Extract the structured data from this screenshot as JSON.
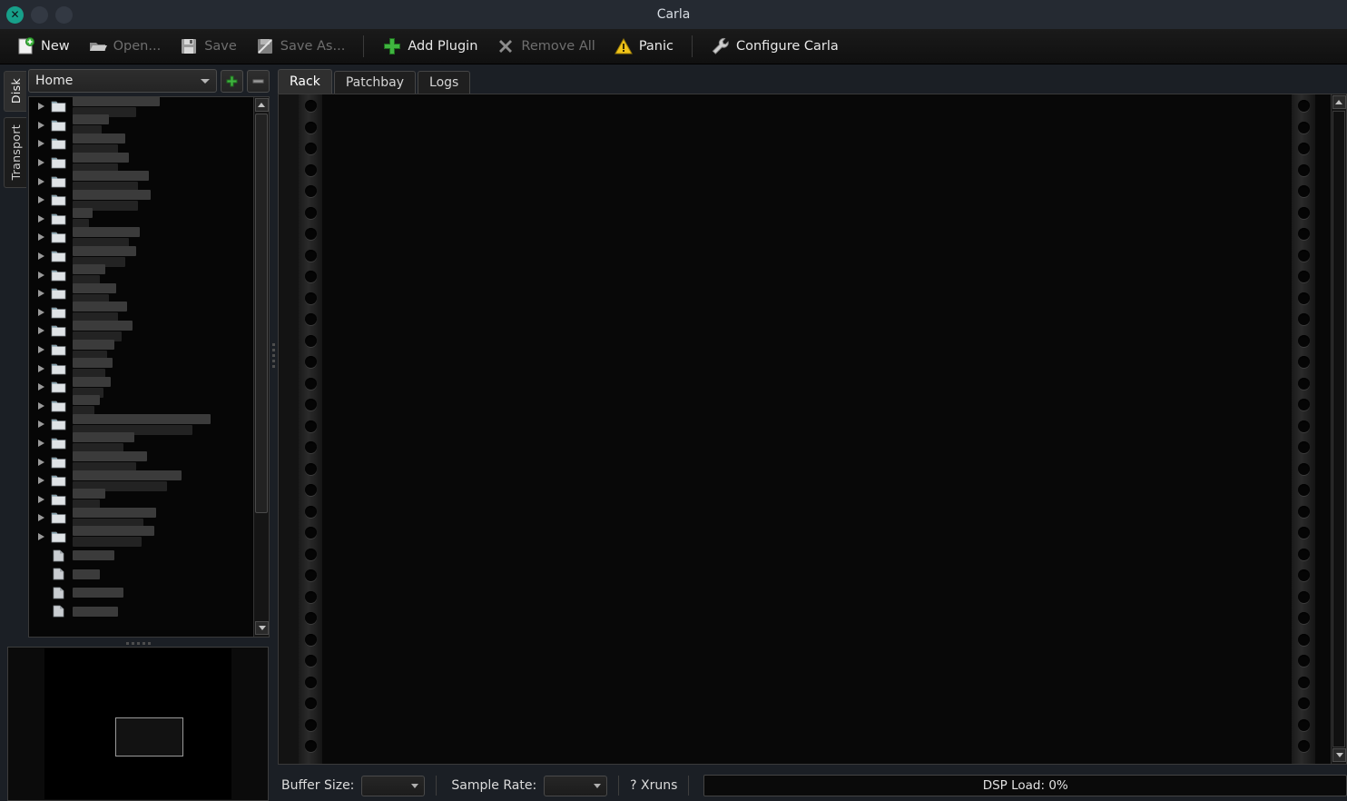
{
  "window": {
    "title": "Carla",
    "buttons": [
      {
        "name": "close-button",
        "glyph": "✕",
        "color": "#17a08a"
      },
      {
        "name": "minimize-button",
        "glyph": "",
        "color": "#333943"
      },
      {
        "name": "maximize-button",
        "glyph": "",
        "color": "#333943"
      }
    ]
  },
  "toolbar": {
    "new_label": "New",
    "open_label": "Open...",
    "save_label": "Save",
    "save_as_label": "Save As...",
    "add_plugin_label": "Add Plugin",
    "remove_all_label": "Remove All",
    "panic_label": "Panic",
    "configure_label": "Configure Carla",
    "icons": {
      "new": "new-file-icon",
      "open": "open-folder-icon",
      "save": "floppy-disk-icon",
      "save_as": "save-as-icon",
      "add_plugin": "plus-icon",
      "remove_all": "x-cross-icon",
      "panic": "warning-triangle-icon",
      "configure": "wrench-icon"
    }
  },
  "side_tabs": [
    {
      "label": "Disk",
      "active": true
    },
    {
      "label": "Transport",
      "active": false
    }
  ],
  "file_browser": {
    "location_value": "Home",
    "add_button_icon": "plus-icon",
    "remove_button_icon": "minus-icon",
    "scroll_up_icon": "chevron-up-icon",
    "scroll_down_icon": "chevron-down-icon",
    "entries": [
      {
        "type": "folder",
        "expandable": true,
        "redacted": true,
        "widths": [
          96,
          70
        ]
      },
      {
        "type": "folder",
        "expandable": true,
        "redacted": true,
        "widths": [
          40,
          32
        ]
      },
      {
        "type": "folder",
        "expandable": true,
        "redacted": true,
        "widths": [
          58,
          50
        ]
      },
      {
        "type": "folder",
        "expandable": true,
        "redacted": true,
        "widths": [
          62,
          50
        ]
      },
      {
        "type": "folder",
        "expandable": true,
        "redacted": true,
        "widths": [
          84,
          72
        ]
      },
      {
        "type": "folder",
        "expandable": true,
        "redacted": true,
        "widths": [
          86,
          72
        ]
      },
      {
        "type": "folder",
        "expandable": true,
        "redacted": true,
        "widths": [
          22,
          18
        ]
      },
      {
        "type": "folder",
        "expandable": true,
        "redacted": true,
        "widths": [
          74,
          62
        ]
      },
      {
        "type": "folder",
        "expandable": true,
        "redacted": true,
        "widths": [
          70,
          58
        ]
      },
      {
        "type": "folder",
        "expandable": true,
        "redacted": true,
        "widths": [
          36,
          30
        ]
      },
      {
        "type": "folder",
        "expandable": true,
        "redacted": true,
        "widths": [
          48,
          40
        ]
      },
      {
        "type": "folder",
        "expandable": true,
        "redacted": true,
        "widths": [
          60,
          50
        ]
      },
      {
        "type": "folder",
        "expandable": true,
        "redacted": true,
        "widths": [
          66,
          54
        ]
      },
      {
        "type": "folder",
        "expandable": true,
        "redacted": true,
        "widths": [
          46,
          38
        ]
      },
      {
        "type": "folder",
        "expandable": true,
        "redacted": true,
        "widths": [
          44,
          36
        ]
      },
      {
        "type": "folder",
        "expandable": true,
        "redacted": true,
        "widths": [
          42,
          34
        ]
      },
      {
        "type": "folder",
        "expandable": true,
        "redacted": true,
        "widths": [
          30,
          24
        ]
      },
      {
        "type": "folder",
        "expandable": true,
        "redacted": true,
        "widths": [
          152,
          132
        ]
      },
      {
        "type": "folder",
        "expandable": true,
        "redacted": true,
        "widths": [
          68,
          56
        ]
      },
      {
        "type": "folder",
        "expandable": true,
        "redacted": true,
        "widths": [
          82,
          70
        ]
      },
      {
        "type": "folder",
        "expandable": true,
        "redacted": true,
        "widths": [
          120,
          104
        ]
      },
      {
        "type": "folder",
        "expandable": true,
        "redacted": true,
        "widths": [
          36,
          30
        ]
      },
      {
        "type": "folder",
        "expandable": true,
        "redacted": true,
        "widths": [
          92,
          78
        ]
      },
      {
        "type": "folder",
        "expandable": true,
        "redacted": true,
        "widths": [
          90,
          76
        ]
      },
      {
        "type": "file",
        "expandable": false,
        "redacted": true,
        "widths": [
          46,
          0
        ]
      },
      {
        "type": "file",
        "expandable": false,
        "redacted": true,
        "widths": [
          30,
          0
        ]
      },
      {
        "type": "file",
        "expandable": false,
        "redacted": true,
        "widths": [
          56,
          0
        ]
      },
      {
        "type": "file",
        "expandable": false,
        "redacted": true,
        "widths": [
          50,
          0
        ]
      }
    ]
  },
  "minimap": {
    "name": "patchbay-minimap",
    "viewport_name": "minimap-viewport"
  },
  "main_tabs": [
    {
      "label": "Rack",
      "active": true
    },
    {
      "label": "Patchbay",
      "active": false
    },
    {
      "label": "Logs",
      "active": false
    }
  ],
  "status": {
    "buffer_size_label": "Buffer Size:",
    "buffer_size_value": "",
    "sample_rate_label": "Sample Rate:",
    "sample_rate_value": "",
    "xruns_label": "? Xruns",
    "dsp_load_label": "DSP Load: 0%"
  },
  "colors": {
    "accent_green": "#3fb53f",
    "close_teal": "#17a08a",
    "warning_yellow": "#f0c419",
    "titlebar": "#252a32",
    "toolbar": "#161616"
  }
}
